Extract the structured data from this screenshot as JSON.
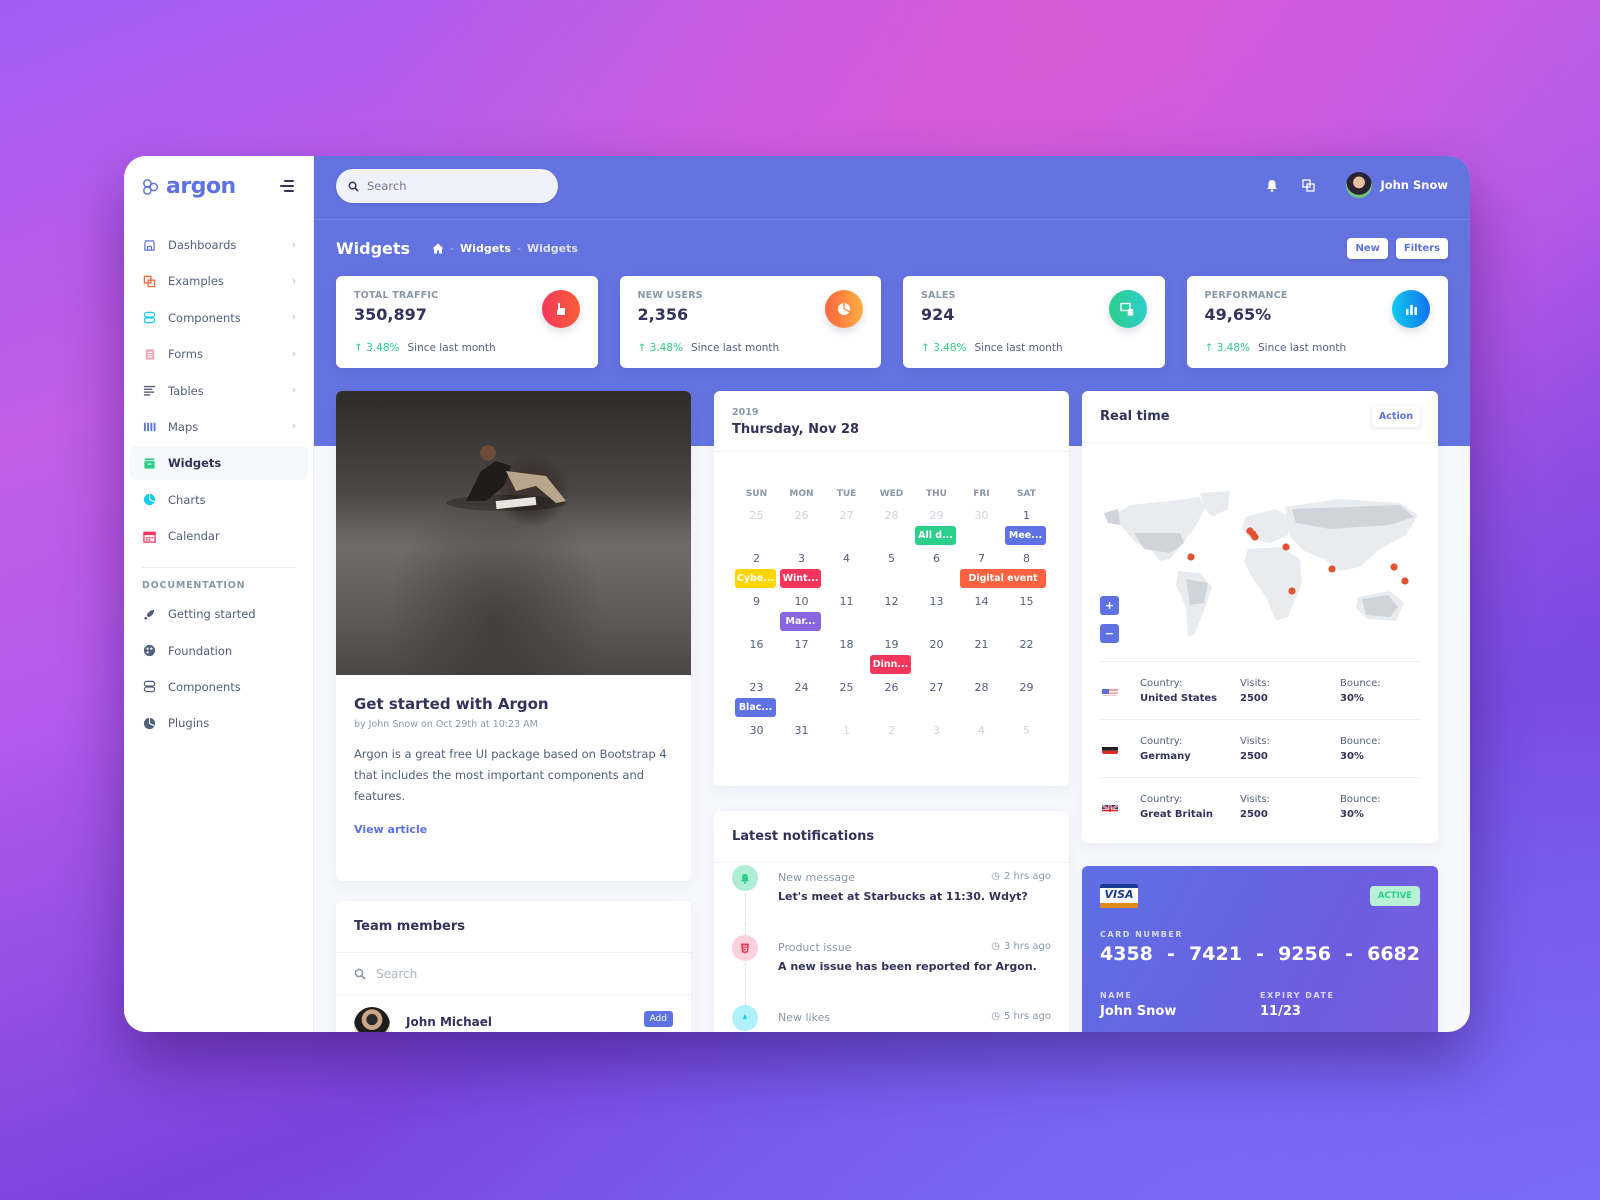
{
  "sidebar": {
    "brand": "argon",
    "items": [
      {
        "label": "Dashboards",
        "icon": "shop-icon",
        "color": "#5e72e4",
        "chevron": true
      },
      {
        "label": "Examples",
        "icon": "ungroup-icon",
        "color": "#f5365c",
        "chevron": true
      },
      {
        "label": "Components",
        "icon": "components-icon",
        "color": "#11cdef",
        "chevron": true
      },
      {
        "label": "Forms",
        "icon": "forms-icon",
        "color": "#f3a4b5",
        "chevron": true
      },
      {
        "label": "Tables",
        "icon": "align-left-icon",
        "color": "#172b4d",
        "chevron": true
      },
      {
        "label": "Maps",
        "icon": "map-icon",
        "color": "#5e72e4",
        "chevron": true
      },
      {
        "label": "Widgets",
        "icon": "archive-icon",
        "color": "#2dce89",
        "active": true
      },
      {
        "label": "Charts",
        "icon": "pie-chart-icon",
        "color": "#11cdef"
      },
      {
        "label": "Calendar",
        "icon": "calendar-icon",
        "color": "#f5365c"
      }
    ],
    "doc_heading": "DOCUMENTATION",
    "doc_items": [
      {
        "label": "Getting started",
        "icon": "spaceship-icon"
      },
      {
        "label": "Foundation",
        "icon": "palette-icon"
      },
      {
        "label": "Components",
        "icon": "ui-components-icon"
      },
      {
        "label": "Plugins",
        "icon": "chart-pie-icon"
      }
    ]
  },
  "topnav": {
    "search_placeholder": "Search",
    "user_name": "John Snow"
  },
  "page": {
    "title": "Widgets",
    "breadcrumb": [
      "Widgets",
      "Widgets"
    ],
    "buttons": {
      "new": "New",
      "filters": "Filters"
    }
  },
  "stats": [
    {
      "title": "TOTAL TRAFFIC",
      "value": "350,897",
      "delta": "3.48%",
      "since": "Since last month",
      "icon": "hand-pointer-icon",
      "gradient": [
        "#f5365c",
        "#f56036"
      ]
    },
    {
      "title": "NEW USERS",
      "value": "2,356",
      "delta": "3.48%",
      "since": "Since last month",
      "icon": "pie-chart-icon",
      "gradient": [
        "#fb6340",
        "#fbb140"
      ]
    },
    {
      "title": "SALES",
      "value": "924",
      "delta": "3.48%",
      "since": "Since last month",
      "icon": "money-coins-icon",
      "gradient": [
        "#2dce89",
        "#2dcecc"
      ]
    },
    {
      "title": "PERFORMANCE",
      "value": "49,65%",
      "delta": "3.48%",
      "since": "Since last month",
      "icon": "bar-chart-icon",
      "gradient": [
        "#11cdef",
        "#1171ef"
      ]
    }
  ],
  "article": {
    "title": "Get started with Argon",
    "meta": "by John Snow on Oct 29th at 10:23 AM",
    "text": "Argon is a great free UI package based on Bootstrap 4 that includes the most important components and features.",
    "link": "View article"
  },
  "team": {
    "title": "Team members",
    "search_placeholder": "Search",
    "members": [
      {
        "name": "John Michael",
        "button": "Add"
      }
    ]
  },
  "calendar": {
    "year": "2019",
    "date": "Thursday, Nov 28",
    "dow": [
      "SUN",
      "MON",
      "TUE",
      "WED",
      "THU",
      "FRI",
      "SAT"
    ],
    "weeks": [
      {
        "days": [
          [
            "25",
            true
          ],
          [
            "26",
            true
          ],
          [
            "27",
            true
          ],
          [
            "28",
            true
          ],
          [
            "29",
            true
          ],
          [
            "30",
            true
          ],
          [
            "1",
            false
          ]
        ],
        "events": [
          {
            "label": "All d...",
            "col": 4,
            "span": 1,
            "color": "#2dce89"
          },
          {
            "label": "Mee...",
            "col": 6,
            "span": 1,
            "color": "#5e72e4"
          }
        ]
      },
      {
        "days": [
          [
            "2",
            false
          ],
          [
            "3",
            false
          ],
          [
            "4",
            false
          ],
          [
            "5",
            false
          ],
          [
            "6",
            false
          ],
          [
            "7",
            false
          ],
          [
            "8",
            false
          ]
        ],
        "events": [
          {
            "label": "Cybe...",
            "col": 0,
            "span": 1,
            "color": "#ffd600"
          },
          {
            "label": "Wint...",
            "col": 1,
            "span": 1,
            "color": "#f5365c"
          },
          {
            "label": "Digital event",
            "col": 5,
            "span": 2,
            "color": "#fb6340"
          }
        ]
      },
      {
        "days": [
          [
            "9",
            false
          ],
          [
            "10",
            false
          ],
          [
            "11",
            false
          ],
          [
            "12",
            false
          ],
          [
            "13",
            false
          ],
          [
            "14",
            false
          ],
          [
            "15",
            false
          ]
        ],
        "events": [
          {
            "label": "Mar...",
            "col": 1,
            "span": 1,
            "color": "#8965e0"
          }
        ]
      },
      {
        "days": [
          [
            "16",
            false
          ],
          [
            "17",
            false
          ],
          [
            "18",
            false
          ],
          [
            "19",
            false
          ],
          [
            "20",
            false
          ],
          [
            "21",
            false
          ],
          [
            "22",
            false
          ]
        ],
        "events": [
          {
            "label": "Dinn...",
            "col": 3,
            "span": 1,
            "color": "#f5365c"
          }
        ]
      },
      {
        "days": [
          [
            "23",
            false
          ],
          [
            "24",
            false
          ],
          [
            "25",
            false
          ],
          [
            "26",
            false
          ],
          [
            "27",
            false
          ],
          [
            "28",
            false
          ],
          [
            "29",
            false
          ]
        ],
        "events": [
          {
            "label": "Blac...",
            "col": 0,
            "span": 1,
            "color": "#5e72e4"
          }
        ]
      },
      {
        "days": [
          [
            "30",
            false
          ],
          [
            "31",
            false
          ],
          [
            "1",
            true
          ],
          [
            "2",
            true
          ],
          [
            "3",
            true
          ],
          [
            "4",
            true
          ],
          [
            "5",
            true
          ]
        ],
        "events": []
      }
    ]
  },
  "notifications": {
    "title": "Latest notifications",
    "items": [
      {
        "title": "New message",
        "time": "2 hrs ago",
        "text": "Let's meet at Starbucks at 11:30. Wdyt?",
        "icon": "bell-icon",
        "bg": "#b0eed3",
        "fg": "#2dce89"
      },
      {
        "title": "Product issue",
        "time": "3 hrs ago",
        "text": "A new issue has been reported for Argon.",
        "icon": "html5-icon",
        "bg": "#fdd1da",
        "fg": "#f5365c"
      },
      {
        "title": "New likes",
        "time": "5 hrs ago",
        "text": "",
        "icon": "like-icon",
        "bg": "#b1f1fb",
        "fg": "#11cdef"
      }
    ]
  },
  "realtime": {
    "title": "Real time",
    "action": "Action",
    "zoom_in": "+",
    "zoom_out": "−",
    "countries": [
      {
        "flag": "us-flag-icon",
        "country_label": "Country:",
        "country": "United States",
        "visits_label": "Visits:",
        "visits": "2500",
        "bounce_label": "Bounce:",
        "bounce": "30%"
      },
      {
        "flag": "de-flag-icon",
        "country_label": "Country:",
        "country": "Germany",
        "visits_label": "Visits:",
        "visits": "2500",
        "bounce_label": "Bounce:",
        "bounce": "30%"
      },
      {
        "flag": "gb-flag-icon",
        "country_label": "Country:",
        "country": "Great Britain",
        "visits_label": "Visits:",
        "visits": "2500",
        "bounce_label": "Bounce:",
        "bounce": "30%"
      }
    ]
  },
  "credit_card": {
    "brand": "VISA",
    "status": "ACTIVE",
    "number_label": "CARD NUMBER",
    "number": [
      "4358",
      "7421",
      "9256",
      "6682"
    ],
    "name_label": "NAME",
    "name": "John Snow",
    "expiry_label": "EXPIRY DATE",
    "expiry": "11/23"
  },
  "colors": {
    "primary": "#5e72e4",
    "success": "#2dce89",
    "danger": "#f5365c",
    "text_dark": "#32325d",
    "muted": "#8898aa"
  }
}
